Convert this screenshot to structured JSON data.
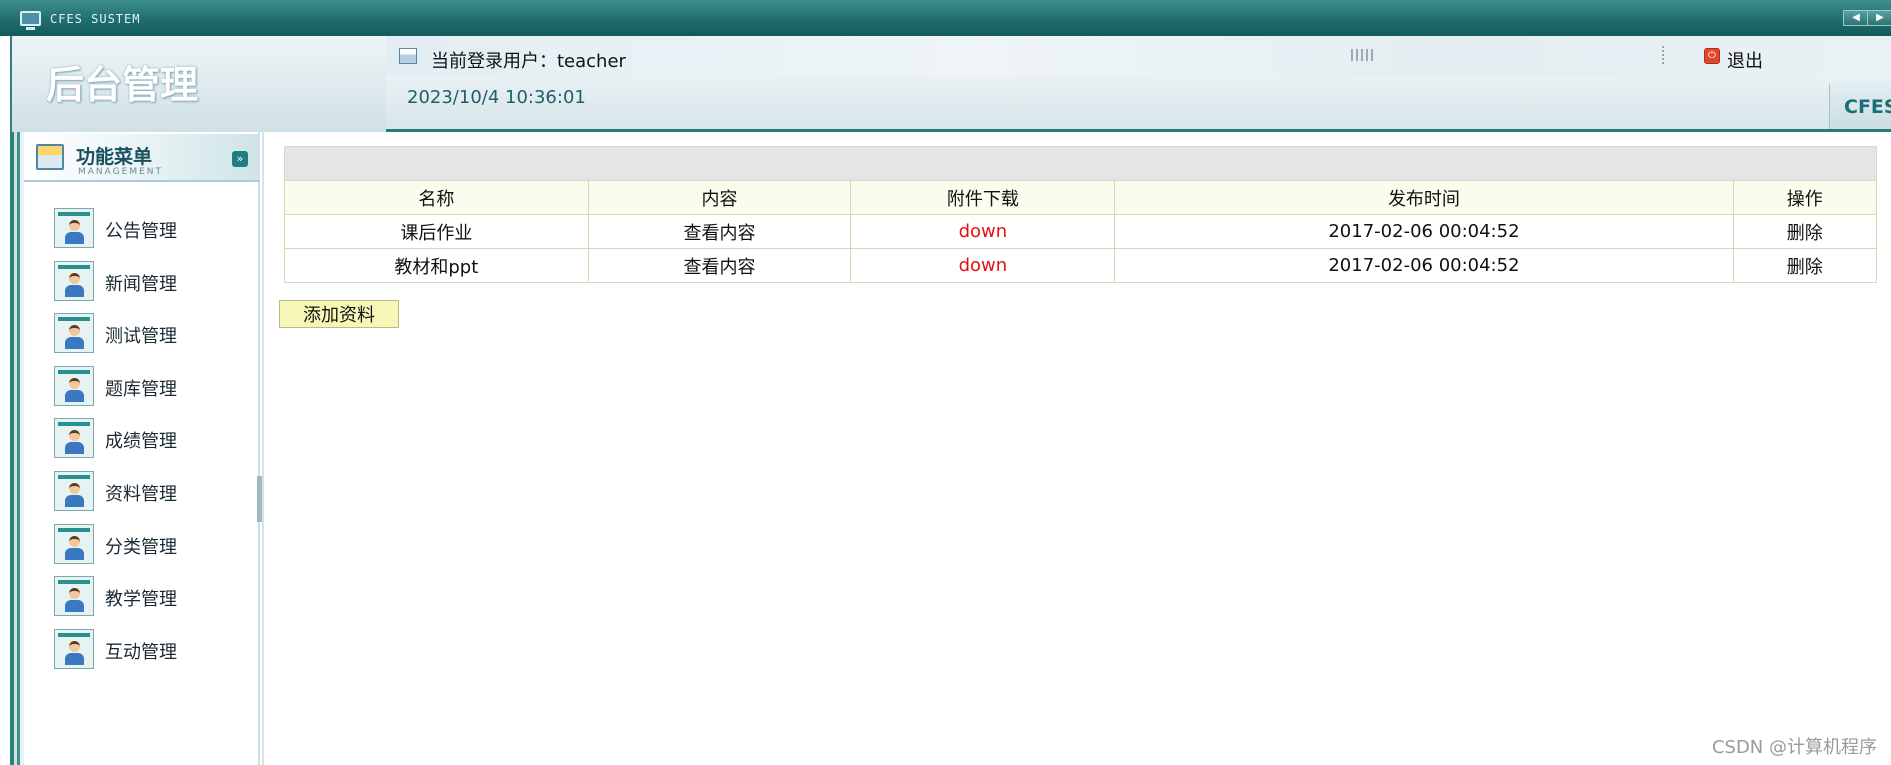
{
  "window": {
    "title": "CFES SUSTEM",
    "nav_prev": "◀",
    "nav_next": "▶"
  },
  "header": {
    "app_title": "后台管理",
    "current_user_text": "当前登录用户：teacher",
    "logout_label": "退出",
    "datetime": "2023/10/4 10:36:01",
    "brand": "CFES"
  },
  "sidebar": {
    "menu_title": "功能菜单",
    "menu_subtitle": "MANAGEMENT",
    "items": [
      {
        "label": "公告管理"
      },
      {
        "label": "新闻管理"
      },
      {
        "label": "测试管理"
      },
      {
        "label": "题库管理"
      },
      {
        "label": "成绩管理"
      },
      {
        "label": "资料管理"
      },
      {
        "label": "分类管理"
      },
      {
        "label": "教学管理"
      },
      {
        "label": "互动管理"
      }
    ]
  },
  "table": {
    "headers": [
      "名称",
      "内容",
      "附件下载",
      "发布时间",
      "操作"
    ],
    "rows": [
      {
        "name": "课后作业",
        "content": "查看内容",
        "download": "down",
        "published": "2017-02-06 00:04:52",
        "action": "删除"
      },
      {
        "name": "教材和ppt",
        "content": "查看内容",
        "download": "down",
        "published": "2017-02-06 00:04:52",
        "action": "删除"
      }
    ]
  },
  "add_button_label": "添加资料",
  "watermark": "CSDN @计算机程序",
  "colors": {
    "titlebar": "#1f6e6e",
    "download_link": "#e31212",
    "add_button_bg": "#f6f7b6",
    "table_header_bg": "#fbfbee"
  }
}
